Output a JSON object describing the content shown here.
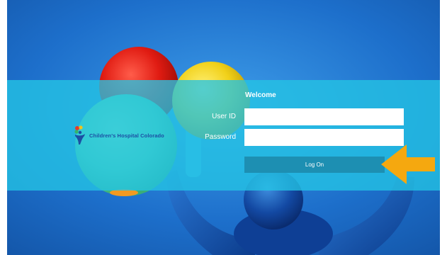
{
  "login": {
    "welcome": "Welcome",
    "user_id_label": "User ID",
    "password_label": "Password",
    "user_id_value": "",
    "password_value": "",
    "logon_label": "Log On"
  },
  "brand": {
    "logo_text": "Children's Hospital Colorado"
  },
  "colors": {
    "background_blue": "#1b6fc8",
    "band_cyan": "#24c4e4",
    "button_teal": "#1d8fb2",
    "arrow_orange": "#f5a80f",
    "logo_text_blue": "#1c4fa3"
  },
  "icons": {
    "arrow": "arrow-left-icon",
    "logo": "kids-logo-icon"
  }
}
